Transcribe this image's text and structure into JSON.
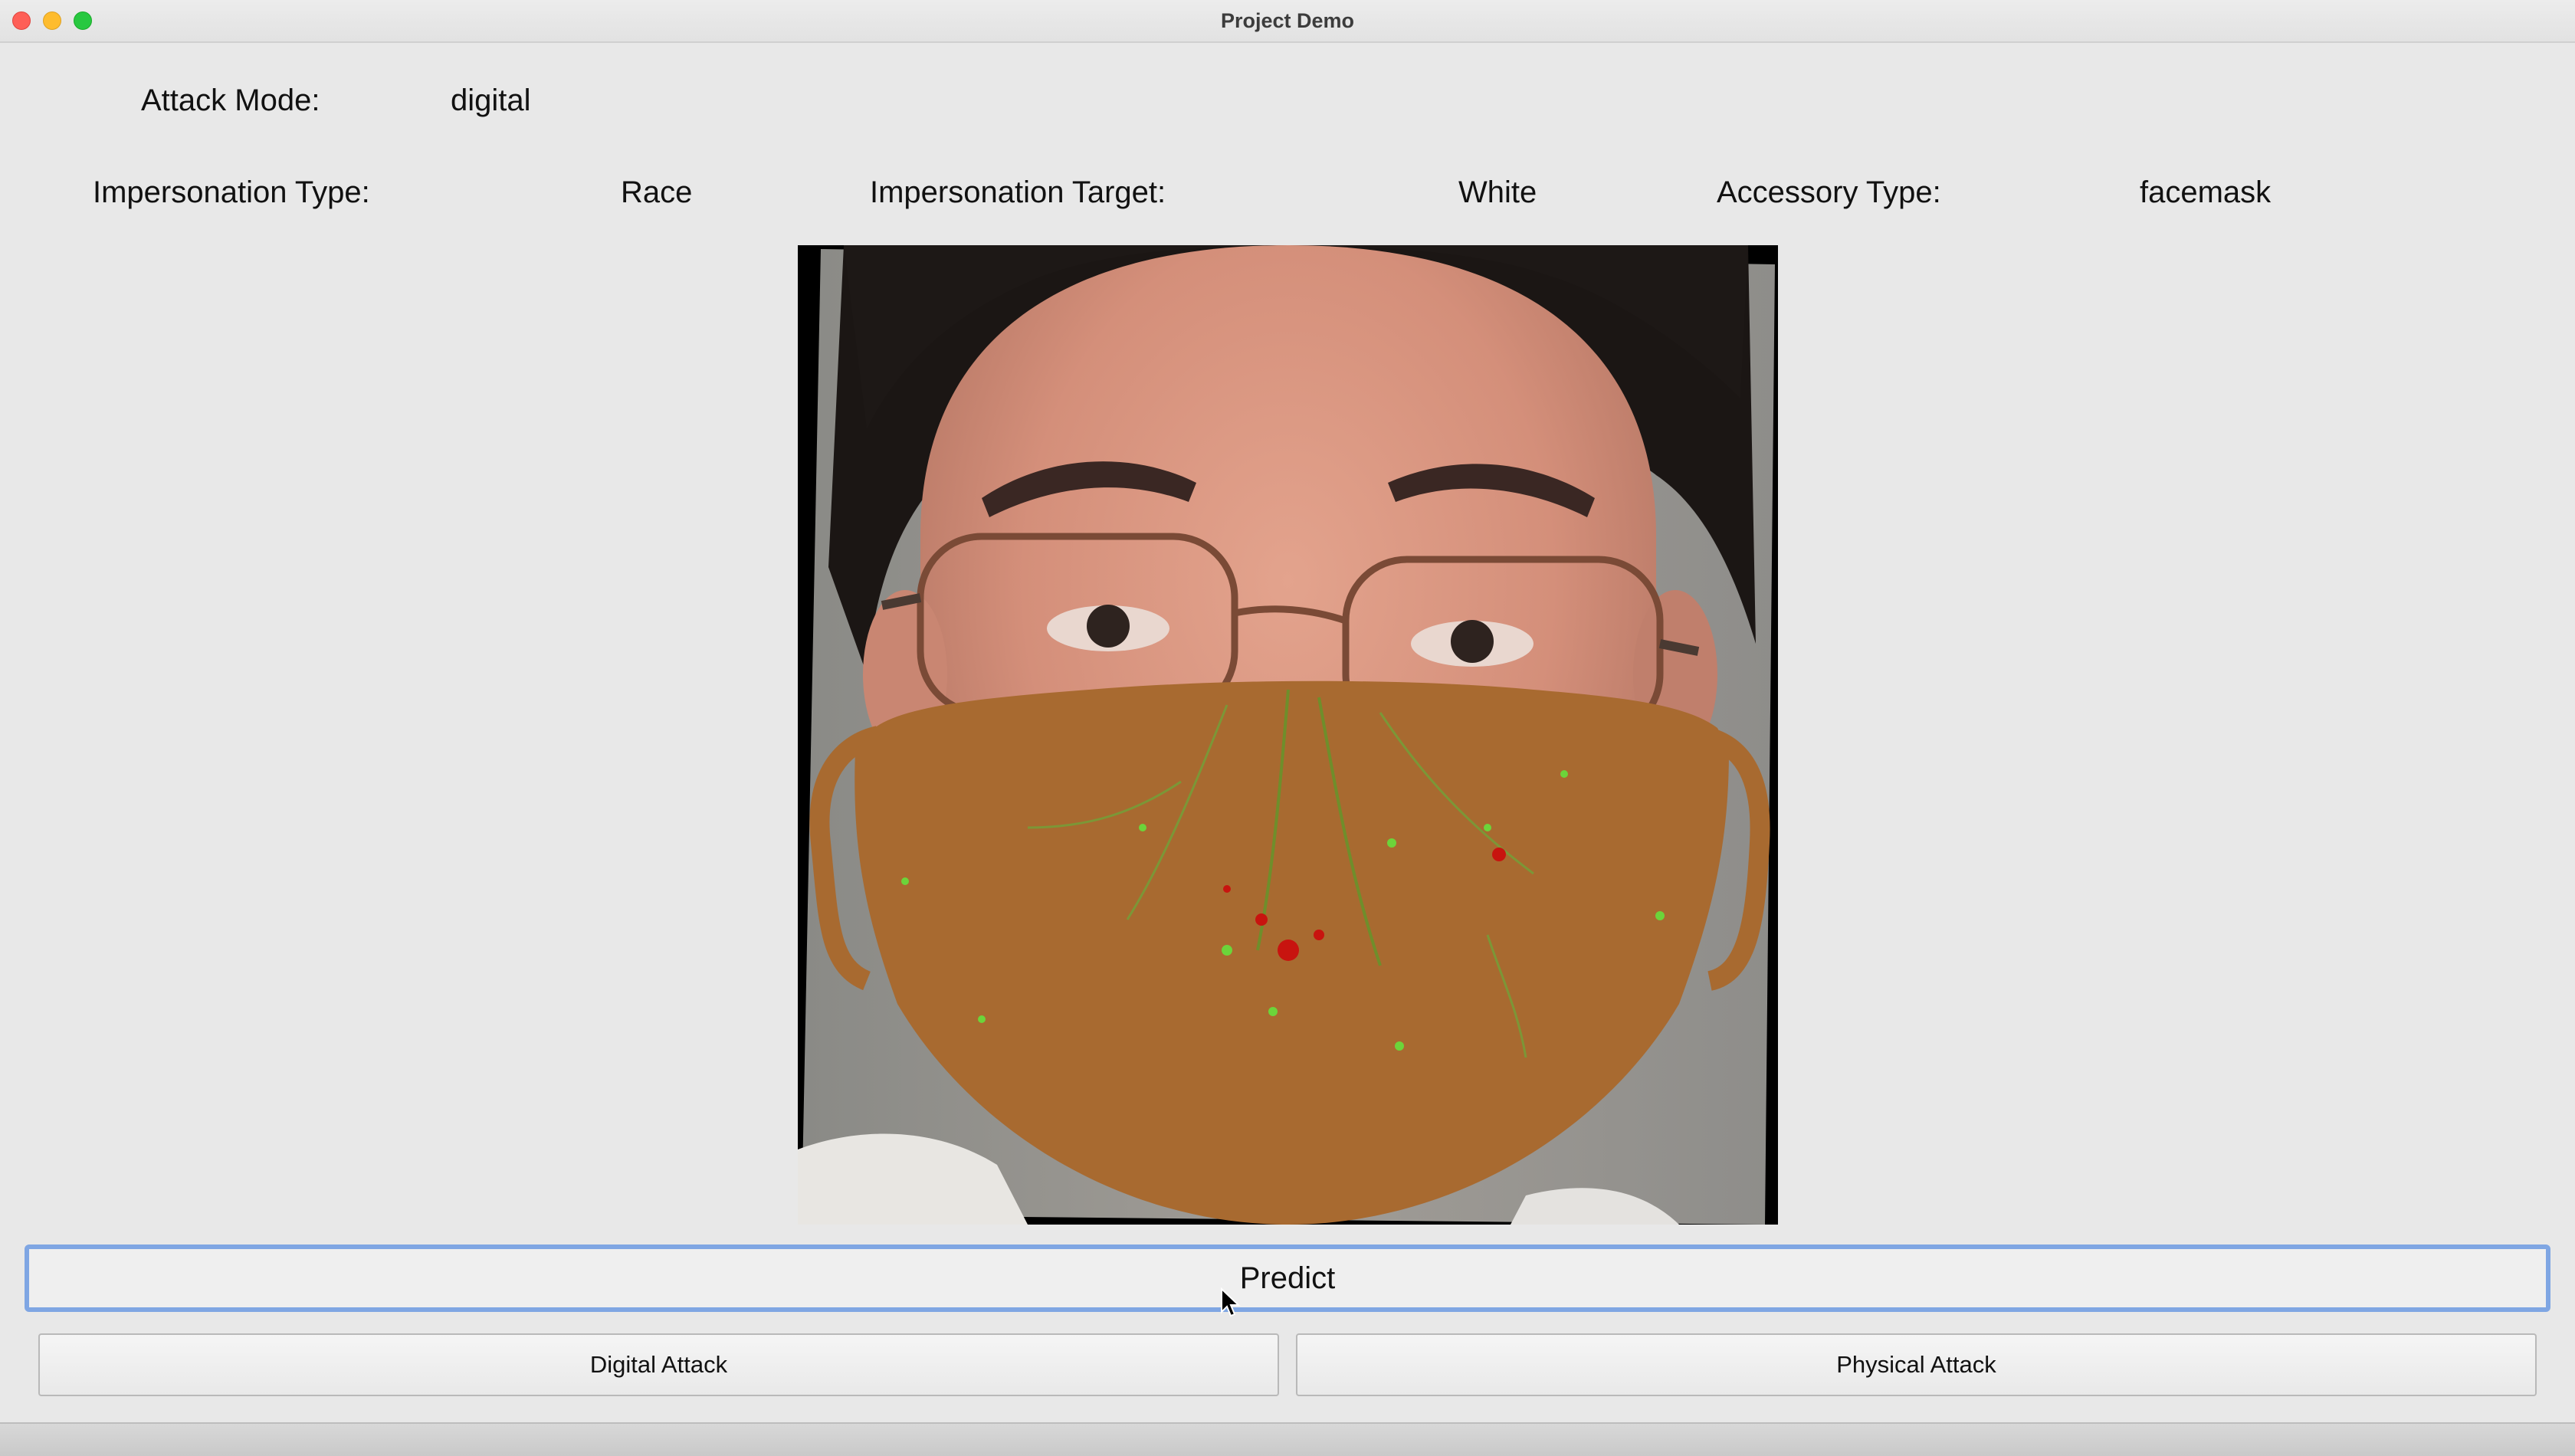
{
  "window": {
    "title": "Project Demo"
  },
  "attack_mode": {
    "label": "Attack Mode:",
    "value": "digital"
  },
  "impersonation_type": {
    "label": "Impersonation Type:",
    "value": "Race"
  },
  "impersonation_target": {
    "label": "Impersonation Target:",
    "value": "White"
  },
  "accessory_type": {
    "label": "Accessory Type:",
    "value": "facemask"
  },
  "buttons": {
    "predict": "Predict",
    "digital_attack": "Digital Attack",
    "physical_attack": "Physical Attack"
  },
  "colors": {
    "focus_ring": "#7fa6e3",
    "mask": "#a86a30"
  },
  "icons": {
    "cursor": "arrow-cursor-icon"
  }
}
